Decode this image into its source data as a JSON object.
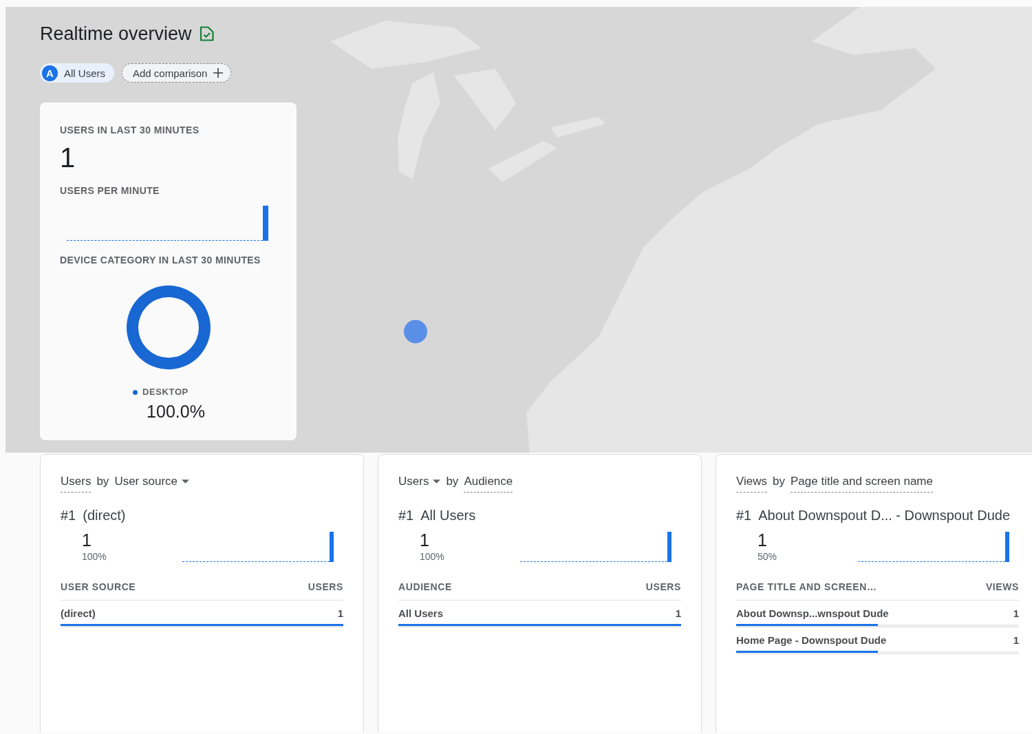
{
  "header": {
    "title": "Realtime overview",
    "segments": [
      {
        "badge": "A",
        "label": "All Users"
      }
    ],
    "add_comparison": "Add comparison"
  },
  "summary": {
    "users_label": "USERS IN LAST 30 MINUTES",
    "users_value": "1",
    "per_minute_label": "USERS PER MINUTE",
    "device_label": "DEVICE CATEGORY IN LAST 30 MINUTES",
    "device_legend": [
      {
        "label": "DESKTOP",
        "share": "100.0%"
      }
    ]
  },
  "cards": [
    {
      "title": {
        "metric": {
          "text": "Users",
          "dropdown": false
        },
        "connector": "by",
        "dimension": {
          "text": "User source",
          "dropdown": true
        }
      },
      "top": {
        "rank": "#1",
        "name": "(direct)",
        "value": "1",
        "share": "100%"
      },
      "table": {
        "columns": [
          "USER SOURCE",
          "USERS"
        ],
        "rows": [
          {
            "label": "(direct)",
            "value": "1",
            "level": 1
          }
        ]
      }
    },
    {
      "title": {
        "metric": {
          "text": "Users",
          "dropdown": true
        },
        "connector": "by",
        "dimension": {
          "text": "Audience",
          "dropdown": false
        }
      },
      "top": {
        "rank": "#1",
        "name": "All Users",
        "value": "1",
        "share": "100%"
      },
      "table": {
        "columns": [
          "AUDIENCE",
          "USERS"
        ],
        "rows": [
          {
            "label": "All Users",
            "value": "1",
            "level": 1
          }
        ]
      }
    },
    {
      "title": {
        "metric": {
          "text": "Views",
          "dropdown": false
        },
        "connector": "by",
        "dimension": {
          "text": "Page title and screen name",
          "dropdown": false
        }
      },
      "top": {
        "rank": "#1",
        "name": "About Downspout D... - Downspout Dude",
        "value": "1",
        "share": "50%"
      },
      "table": {
        "columns": [
          "PAGE TITLE AND SCREEN…",
          "VIEWS"
        ],
        "rows": [
          {
            "label": "About Downsp...wnspout Dude",
            "value": "1",
            "level": 0.5
          },
          {
            "label": "Home Page - Downspout Dude",
            "value": "1",
            "level": 0.5
          }
        ]
      }
    }
  ]
}
